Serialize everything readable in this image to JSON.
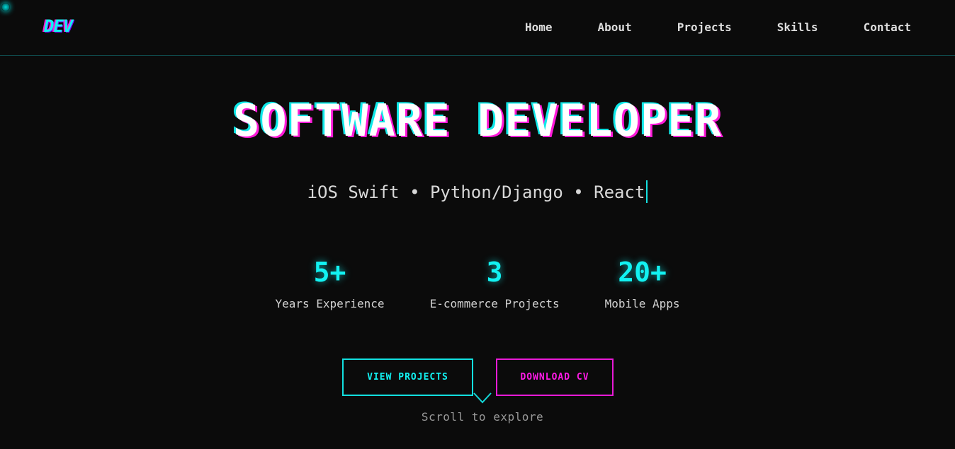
{
  "header": {
    "logo": "DEV",
    "nav": [
      "Home",
      "About",
      "Projects",
      "Skills",
      "Contact"
    ]
  },
  "hero": {
    "title": "SOFTWARE DEVELOPER",
    "subtitle": "iOS Swift • Python/Django • React"
  },
  "stats": [
    {
      "value": "5+",
      "label": "Years Experience"
    },
    {
      "value": "3",
      "label": "E-commerce Projects"
    },
    {
      "value": "20+",
      "label": "Mobile Apps"
    }
  ],
  "buttons": {
    "view_projects": "VIEW PROJECTS",
    "download_cv": "DOWNLOAD CV"
  },
  "scroll_hint": "Scroll to explore",
  "icons": {
    "cursor": "glow-dot-icon",
    "scroll": "chevron-down-icon"
  },
  "colors": {
    "background": "#0b0b0b",
    "accent_cyan": "#12f2f2",
    "accent_magenta": "#ff1ae6"
  }
}
